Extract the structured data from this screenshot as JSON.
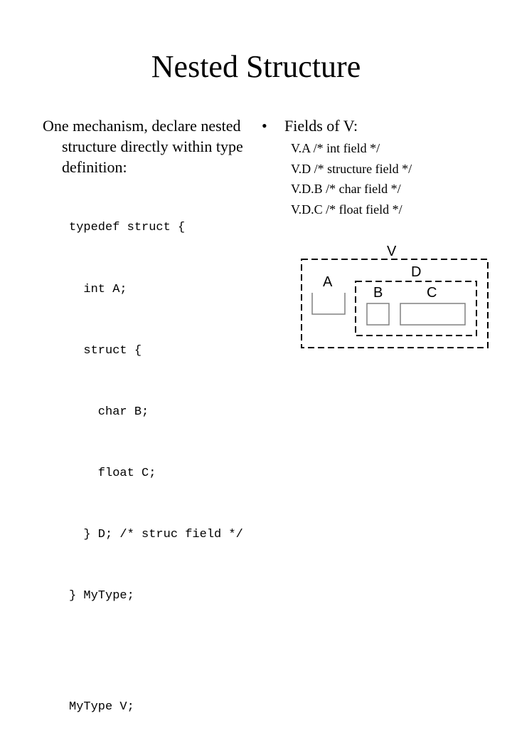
{
  "slide": {
    "title": "Nested Structure",
    "left": {
      "bullet_line1": "One mechanism, declare nested",
      "bullet_line2": "structure directly within type",
      "bullet_line3": "definition:",
      "code_lines": [
        "typedef struct {",
        "  int A;",
        "  struct {",
        "    char B;",
        "    float C;",
        "  } D; /* struc field */",
        "} MyType;"
      ],
      "code_decl": "MyType V;"
    },
    "right": {
      "bullet_symbol": "•",
      "heading": "Fields of V:",
      "fields": [
        "V.A /* int field */",
        "V.D /* structure field */",
        "V.D.B /* char field */",
        "V.D.C /* float field */"
      ]
    },
    "diagram": {
      "labels": {
        "V": "V",
        "D": "D",
        "A": "A",
        "B": "B",
        "C": "C"
      },
      "colors": {
        "dashed_border": "#000000",
        "field_box": "#808080"
      }
    }
  }
}
